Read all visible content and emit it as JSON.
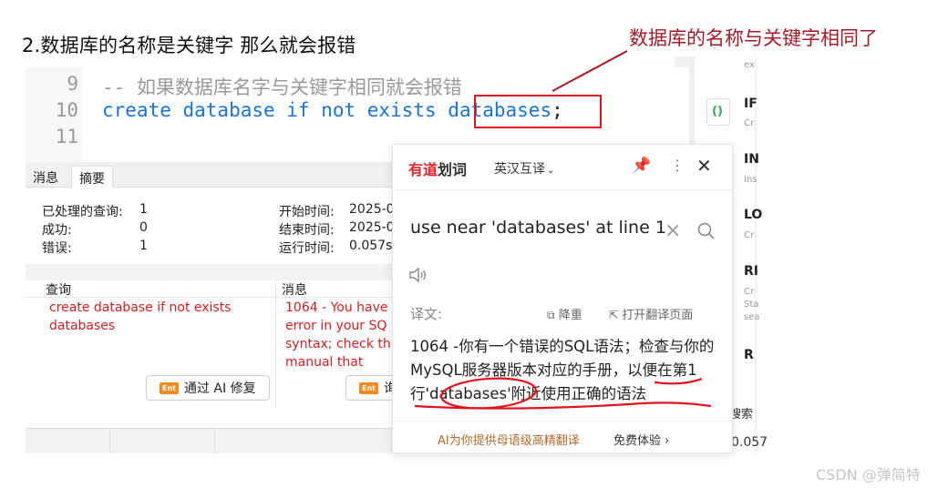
{
  "heading": "2.数据库的名称是关键字 那么就会报错",
  "callout": "数据库的名称与关键字相同了",
  "editor": {
    "lines": [
      {
        "num": "9",
        "code": "-- 如果数据库名字与关键字相同就会报错"
      },
      {
        "num": "10",
        "code_prefix": "create database if not exists ",
        "code_highlight": "databases",
        "code_suffix": ";"
      },
      {
        "num": "11",
        "code": ""
      }
    ]
  },
  "results": {
    "tabs": [
      "消息",
      "摘要"
    ],
    "active_tab": "摘要",
    "stats_left": [
      {
        "label": "已处理的查询:",
        "value": "1"
      },
      {
        "label": "成功:",
        "value": "0"
      },
      {
        "label": "错误:",
        "value": "1"
      }
    ],
    "stats_right": [
      {
        "label": "开始时间:",
        "value": "2025-0"
      },
      {
        "label": "结束时间:",
        "value": "2025-0"
      },
      {
        "label": "运行时间:",
        "value": "0.057s"
      }
    ],
    "columns": [
      "查询",
      "消息"
    ],
    "query_text_line1": "create database if not exists",
    "query_text_line2": "databases",
    "message_lines": [
      "1064 - You have",
      "error in your SQ",
      "syntax; check th",
      "manual that"
    ],
    "ai_fix_badge": "Ent",
    "ai_fix_label": "通过 AI 修复",
    "ai_fix_label2": "询"
  },
  "popup": {
    "logo_youdao": "有道",
    "logo_suffix": "划词",
    "lang": "英汉互译",
    "query": "use near 'databases' at line 1",
    "translation_label": "译文:",
    "dedupe": "降重",
    "open_page": "打开翻译页面",
    "translation": "1064 -你有一个错误的SQL语法；检查与你的MySQL服务器版本对应的手册，以便在第1行'databases'附近使用正确的语法",
    "ai_promo": "AI为你提供母语级高精翻译",
    "free_trial": "免费体验"
  },
  "right_panel": {
    "items": [
      {
        "title": "",
        "sub": "ex"
      },
      {
        "title": "IF",
        "sub": "Cr"
      },
      {
        "title": "IN",
        "sub": "Ins"
      },
      {
        "title": "LO",
        "sub": "Cr"
      },
      {
        "title": "RI",
        "sub": "Cr\nSta\nsea"
      },
      {
        "title": "R",
        "sub": ""
      }
    ],
    "search_label": "搜索",
    "num": "0.057"
  },
  "watermark": "CSDN @弹简特"
}
